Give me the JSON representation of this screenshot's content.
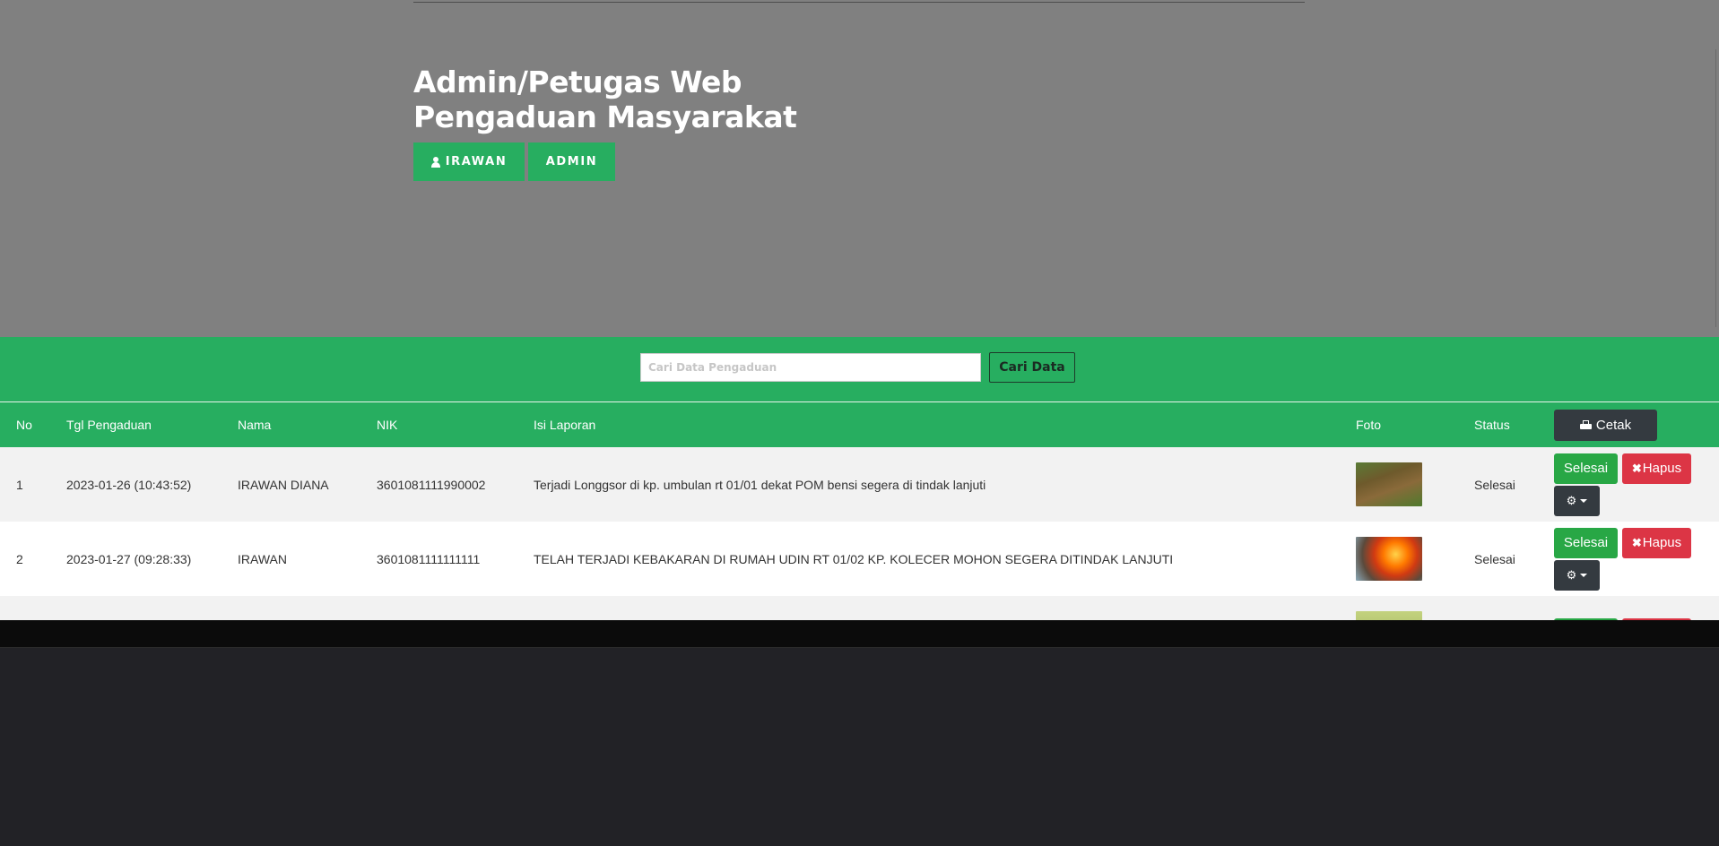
{
  "header": {
    "title": "Admin/Petugas Web Pengaduan Masyarakat",
    "user_label": "IRAWAN",
    "role_label": "ADMIN",
    "user_icon": "user-icon"
  },
  "search": {
    "placeholder": "Cari Data Pengaduan",
    "value": "",
    "button_label": "Cari Data"
  },
  "table": {
    "columns": {
      "no": "No",
      "tgl": "Tgl Pengaduan",
      "nama": "Nama",
      "nik": "NIK",
      "isi": "Isi Laporan",
      "foto": "Foto",
      "status": "Status",
      "cetak": "Cetak"
    },
    "rows": [
      {
        "no": "1",
        "tgl": "2023-01-26 (10:43:52)",
        "nama": "IRAWAN DIANA",
        "nik": "3601081111990002",
        "isi": "Terjadi Longgsor di kp. umbulan rt 01/01 dekat POM bensi segera di tindak lanjuti",
        "foto": "landslide-photo",
        "status": "Selesai"
      },
      {
        "no": "2",
        "tgl": "2023-01-27 (09:28:33)",
        "nama": "IRAWAN",
        "nik": "3601081111111111",
        "isi": "TELAH TERJADI KEBAKARAN DI RUMAH UDIN RT 01/02 KP. KOLECER MOHON SEGERA DITINDAK LANJUTI",
        "foto": "fire-photo",
        "status": "Selesai"
      },
      {
        "no": "",
        "tgl": "",
        "nama": "",
        "nik": "",
        "isi": "",
        "foto": "field-photo",
        "status": ""
      }
    ],
    "action_labels": {
      "selesai": "Selesai",
      "hapus": "Hapus"
    }
  },
  "colors": {
    "hero_bg": "#808080",
    "accent_green": "#27ae60",
    "danger": "#dc3545",
    "dark": "#343a40",
    "page_bg": "#222226"
  }
}
